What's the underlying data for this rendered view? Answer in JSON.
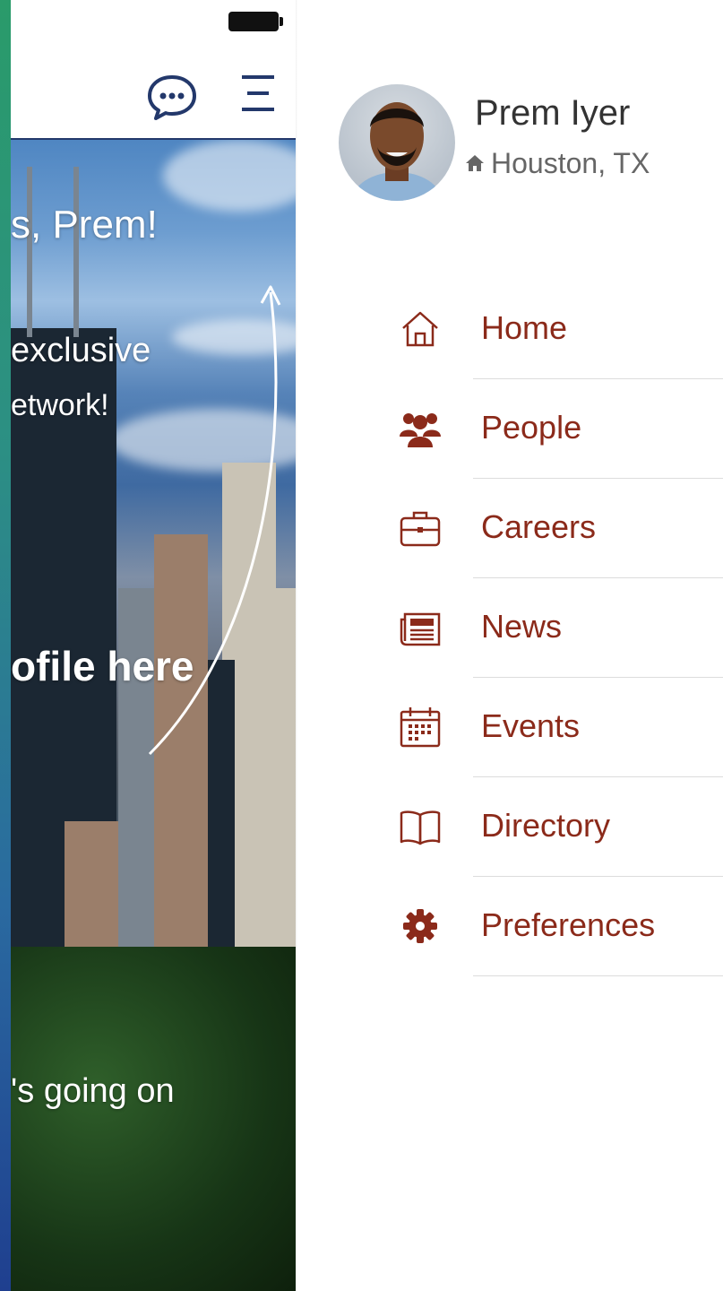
{
  "app": {
    "header": {
      "chat_icon": "chat-bubble-icon",
      "menu_icon": "hamburger-menu-icon",
      "rule_color": "#23386b"
    },
    "hero": {
      "greeting": "s, Prem!",
      "line1": " exclusive",
      "line2": "etwork!",
      "profile_hint": "ofile here",
      "going_on": "'s going on"
    }
  },
  "drawer": {
    "user": {
      "name": "Prem Iyer",
      "location": "Houston, TX",
      "location_icon": "home-icon"
    },
    "menu": {
      "accent_color": "#8b2a1a",
      "items": [
        {
          "label": "Home",
          "icon": "home-icon"
        },
        {
          "label": "People",
          "icon": "people-icon"
        },
        {
          "label": "Careers",
          "icon": "briefcase-icon"
        },
        {
          "label": "News",
          "icon": "newspaper-icon"
        },
        {
          "label": "Events",
          "icon": "calendar-icon"
        },
        {
          "label": "Directory",
          "icon": "book-icon"
        },
        {
          "label": "Preferences",
          "icon": "gear-icon"
        }
      ]
    }
  }
}
